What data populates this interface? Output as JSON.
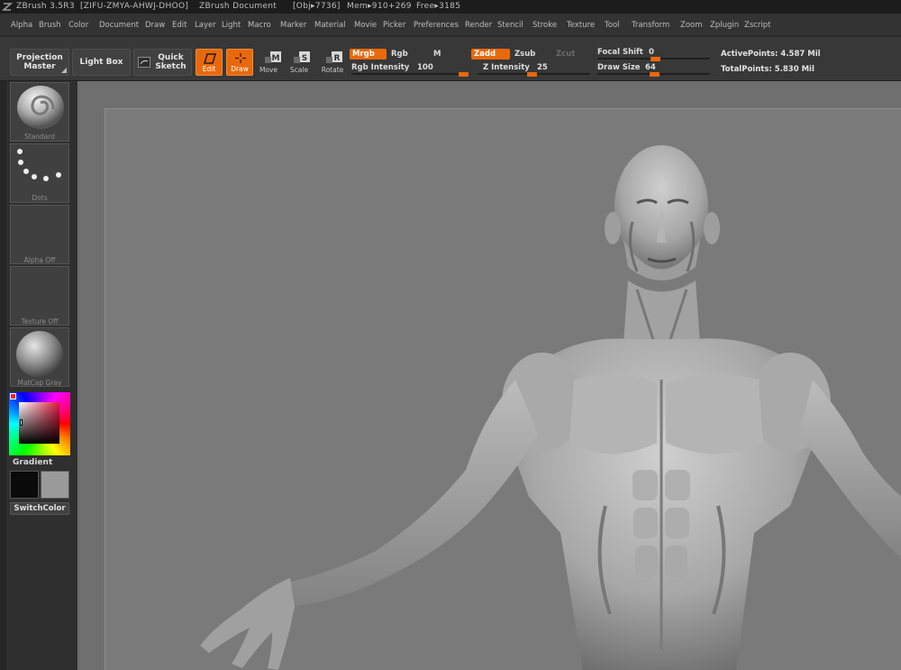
{
  "titlebar": {
    "app": "ZBrush 3.5R3",
    "license": "[ZIFU-ZMYA-AHWJ-DHOO]",
    "document": "ZBrush Document",
    "obj": "[Obj▸7736]",
    "mem": "Mem▸910+269",
    "free": "Free▸3185"
  },
  "menu": [
    "Alpha",
    "Brush",
    "Color",
    "Document",
    "Draw",
    "Edit",
    "Layer",
    "Light",
    "Macro",
    "Marker",
    "Material",
    "Movie",
    "Picker",
    "Preferences",
    "Render",
    "Stencil",
    "Stroke",
    "Texture",
    "Tool",
    "Transform",
    "Zoom",
    "Zplugin",
    "Zscript"
  ],
  "shelf": {
    "projection_master": [
      "Projection",
      "Master"
    ],
    "light_box": "Light Box",
    "quick_sketch": [
      "Quick",
      "Sketch"
    ],
    "edit": "Edit",
    "draw": "Draw",
    "move": "Move",
    "scale": "Scale",
    "rotate": "Rotate",
    "mrgb": "Mrgb",
    "rgb": "Rgb",
    "m": "M",
    "rgb_intensity": "Rgb Intensity",
    "rgb_intensity_value": "100",
    "zadd": "Zadd",
    "zsub": "Zsub",
    "zcut": "Zcut",
    "z_intensity": "Z Intensity",
    "z_intensity_value": "25",
    "focal_shift": "Focal Shift",
    "focal_shift_value": "0",
    "draw_size": "Draw Size",
    "draw_size_value": "64",
    "active_points": "ActivePoints: 4.587 Mil",
    "total_points": "TotalPoints: 5.830 Mil"
  },
  "left": {
    "brush": "Standard",
    "stroke": "Dots",
    "alpha": "Alpha Off",
    "texture": "Texture Off",
    "material": "MatCap Gray",
    "gradient": "Gradient",
    "switch_color": "SwitchColor",
    "main_color": "#0a0a0a",
    "secondary_color": "#9a9a9a"
  },
  "colors": {
    "accent": "#e8690c",
    "canvas": "#6f6f6f"
  }
}
